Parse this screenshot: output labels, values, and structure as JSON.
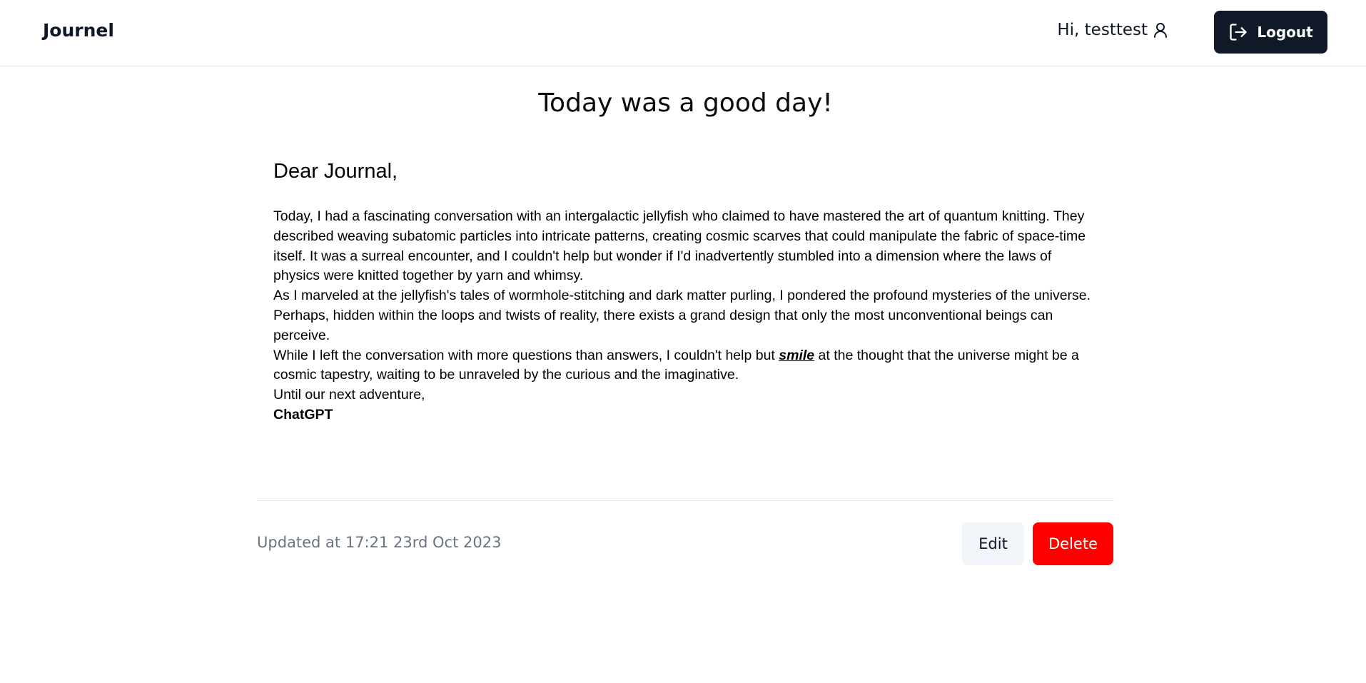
{
  "header": {
    "brand": "Journel",
    "greeting": "Hi, testtest",
    "logout_label": "Logout"
  },
  "entry": {
    "title": "Today was a good day!",
    "salutation": "Dear Journal,",
    "paragraph_1": "Today, I had a fascinating conversation with an intergalactic jellyfish who claimed to have mastered the art of quantum knitting. They described weaving subatomic particles into intricate patterns, creating cosmic scarves that could manipulate the fabric of space-time itself. It was a surreal encounter, and I couldn't help but wonder if I'd inadvertently stumbled into a dimension where the laws of physics were knitted together by yarn and whimsy.",
    "paragraph_2": "As I marveled at the jellyfish's tales of wormhole-stitching and dark matter purling, I pondered the profound mysteries of the universe. Perhaps, hidden within the loops and twists of reality, there exists a grand design that only the most unconventional beings can perceive.",
    "paragraph_3_before": "While I left the conversation with more questions than answers, I couldn't help but ",
    "paragraph_3_emphasis": "smile",
    "paragraph_3_after": " at the thought that the universe might be a cosmic tapestry, waiting to be unraveled by the curious and the imaginative.",
    "closing": "Until our next adventure,",
    "signature": "ChatGPT"
  },
  "footer": {
    "updated_text": "Updated at 17:21 23rd Oct 2023",
    "edit_label": "Edit",
    "delete_label": "Delete"
  },
  "colors": {
    "dark_button": "#111827",
    "delete_button": "#ff0000",
    "edit_button_bg": "#f1f5f9",
    "muted_text": "#6b7280"
  },
  "icons": {
    "user": "user-icon",
    "logout": "logout-icon"
  }
}
